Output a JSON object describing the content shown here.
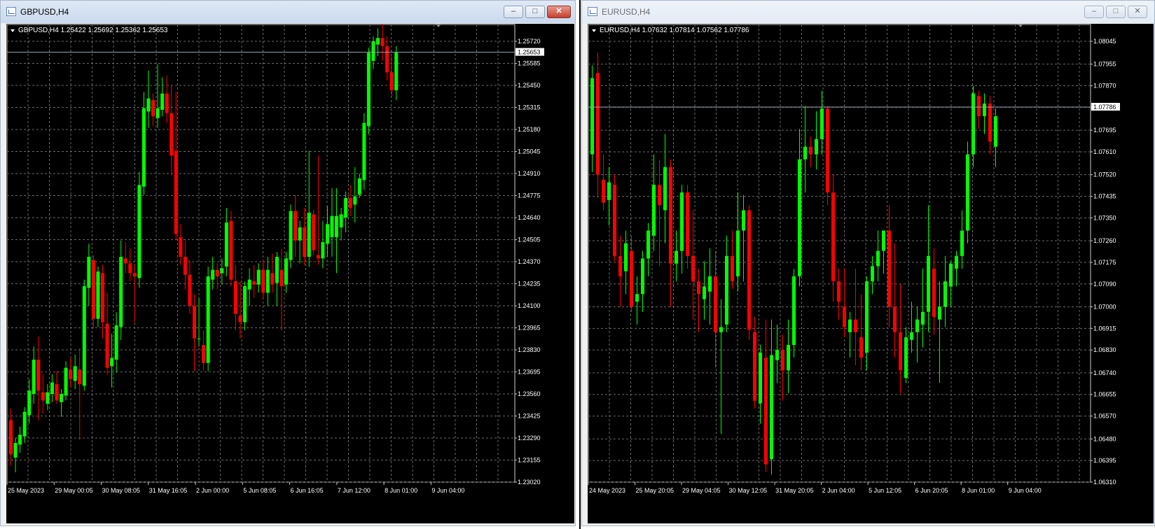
{
  "windows": [
    {
      "title": "GBPUSD,H4",
      "header": "GBPUSD,H4  1.25422 1.25692 1.25362 1.25653",
      "current_price": "1.25653",
      "chart_data": {
        "type": "candlestick",
        "symbol": "GBPUSD",
        "timeframe": "H4",
        "ylim": [
          1.2302,
          1.2579
        ],
        "y_ticks": [
          "1.25720",
          "1.25585",
          "1.25450",
          "1.25315",
          "1.25180",
          "1.25045",
          "1.24910",
          "1.24775",
          "1.24640",
          "1.24505",
          "1.24370",
          "1.24235",
          "1.24100",
          "1.23965",
          "1.23830",
          "1.23695",
          "1.23560",
          "1.23425",
          "1.23290",
          "1.23155",
          "1.23020"
        ],
        "x_labels": [
          "25 May 2023",
          "29 May 00:05",
          "30 May 08:05",
          "31 May 16:05",
          "2 Jun 00:00",
          "5 Jun 08:05",
          "6 Jun 16:05",
          "7 Jun 12:00",
          "8 Jun 01:00",
          "9 Jun 04:00"
        ],
        "last_price": 1.25653,
        "candles": [
          [
            1.234,
            1.2347,
            1.2312,
            1.2319
          ],
          [
            1.2317,
            1.2329,
            1.2308,
            1.2326
          ],
          [
            1.2325,
            1.2336,
            1.232,
            1.2331
          ],
          [
            1.233,
            1.2348,
            1.2326,
            1.2345
          ],
          [
            1.2343,
            1.2365,
            1.2338,
            1.2358
          ],
          [
            1.2356,
            1.2385,
            1.235,
            1.2377
          ],
          [
            1.2377,
            1.2391,
            1.234,
            1.2358
          ],
          [
            1.2357,
            1.2368,
            1.2344,
            1.2352
          ],
          [
            1.235,
            1.2362,
            1.2346,
            1.2357
          ],
          [
            1.2356,
            1.2368,
            1.2351,
            1.2363
          ],
          [
            1.2362,
            1.237,
            1.235,
            1.2352
          ],
          [
            1.2351,
            1.2359,
            1.2342,
            1.2356
          ],
          [
            1.2355,
            1.2376,
            1.2352,
            1.2372
          ],
          [
            1.2371,
            1.2378,
            1.236,
            1.2365
          ],
          [
            1.2364,
            1.238,
            1.2359,
            1.2373
          ],
          [
            1.2371,
            1.2384,
            1.2328,
            1.2362
          ],
          [
            1.2361,
            1.2426,
            1.2358,
            1.2422
          ],
          [
            1.2421,
            1.2448,
            1.241,
            1.244
          ],
          [
            1.2438,
            1.2441,
            1.2396,
            1.2402
          ],
          [
            1.2402,
            1.2434,
            1.2397,
            1.2431
          ],
          [
            1.243,
            1.2435,
            1.239,
            1.24
          ],
          [
            1.2399,
            1.2418,
            1.2368,
            1.2372
          ],
          [
            1.2373,
            1.2393,
            1.236,
            1.2378
          ],
          [
            1.2377,
            1.2406,
            1.2369,
            1.2398
          ],
          [
            1.2397,
            1.245,
            1.2389,
            1.244
          ],
          [
            1.2439,
            1.2449,
            1.243,
            1.2436
          ],
          [
            1.2436,
            1.2445,
            1.2425,
            1.243
          ],
          [
            1.243,
            1.2435,
            1.24,
            1.2428
          ],
          [
            1.2427,
            1.2492,
            1.2421,
            1.2484
          ],
          [
            1.2483,
            1.2541,
            1.2478,
            1.2531
          ],
          [
            1.2529,
            1.2554,
            1.2519,
            1.2537
          ],
          [
            1.2536,
            1.254,
            1.252,
            1.2526
          ],
          [
            1.2525,
            1.2558,
            1.2519,
            1.2531
          ],
          [
            1.253,
            1.255,
            1.2526,
            1.254
          ],
          [
            1.254,
            1.2551,
            1.2522,
            1.2528
          ],
          [
            1.2528,
            1.2545,
            1.249,
            1.2502
          ],
          [
            1.2505,
            1.2541,
            1.245,
            1.2454
          ],
          [
            1.2452,
            1.246,
            1.2435,
            1.244
          ],
          [
            1.244,
            1.245,
            1.242,
            1.2429
          ],
          [
            1.2429,
            1.2438,
            1.2405,
            1.241
          ],
          [
            1.241,
            1.2417,
            1.237,
            1.239
          ],
          [
            1.239,
            1.2415,
            1.2385,
            1.239
          ],
          [
            1.2386,
            1.2395,
            1.237,
            1.2375
          ],
          [
            1.2375,
            1.2434,
            1.237,
            1.2428
          ],
          [
            1.2426,
            1.244,
            1.242,
            1.2432
          ],
          [
            1.2432,
            1.2436,
            1.242,
            1.2428
          ],
          [
            1.243,
            1.2439,
            1.2423,
            1.2433
          ],
          [
            1.2434,
            1.247,
            1.2428,
            1.2461
          ],
          [
            1.2462,
            1.2468,
            1.2422,
            1.2426
          ],
          [
            1.2425,
            1.2435,
            1.2395,
            1.2405
          ],
          [
            1.2404,
            1.2425,
            1.239,
            1.24
          ],
          [
            1.24,
            1.2425,
            1.2395,
            1.2422
          ],
          [
            1.242,
            1.2433,
            1.241,
            1.2426
          ],
          [
            1.2425,
            1.2435,
            1.2415,
            1.2423
          ],
          [
            1.2423,
            1.2436,
            1.2418,
            1.2432
          ],
          [
            1.2432,
            1.2438,
            1.2414,
            1.2418
          ],
          [
            1.2418,
            1.244,
            1.241,
            1.2432
          ],
          [
            1.243,
            1.2442,
            1.2418,
            1.2423
          ],
          [
            1.2424,
            1.2443,
            1.241,
            1.244
          ],
          [
            1.2432,
            1.2445,
            1.2395,
            1.2422
          ],
          [
            1.2423,
            1.2443,
            1.2418,
            1.2439
          ],
          [
            1.2438,
            1.2472,
            1.2433,
            1.2468
          ],
          [
            1.2468,
            1.2478,
            1.244,
            1.245
          ],
          [
            1.245,
            1.2462,
            1.2436,
            1.2458
          ],
          [
            1.2458,
            1.247,
            1.2435,
            1.244
          ],
          [
            1.244,
            1.2505,
            1.2434,
            1.2467
          ],
          [
            1.2466,
            1.2469,
            1.2441,
            1.2444
          ],
          [
            1.2441,
            1.2502,
            1.2435,
            1.2439
          ],
          [
            1.2439,
            1.2462,
            1.2433,
            1.2449
          ],
          [
            1.2448,
            1.2471,
            1.244,
            1.246
          ],
          [
            1.2452,
            1.2482,
            1.244,
            1.2465
          ],
          [
            1.2452,
            1.2482,
            1.243,
            1.2465
          ],
          [
            1.2458,
            1.247,
            1.245,
            1.2466
          ],
          [
            1.2464,
            1.248,
            1.2455,
            1.2476
          ],
          [
            1.2476,
            1.2484,
            1.2465,
            1.247
          ],
          [
            1.2472,
            1.2495,
            1.2461,
            1.2477
          ],
          [
            1.2478,
            1.2491,
            1.2476,
            1.2488
          ],
          [
            1.2487,
            1.2528,
            1.2481,
            1.2522
          ],
          [
            1.252,
            1.2568,
            1.2515,
            1.2565
          ],
          [
            1.256,
            1.2575,
            1.2555,
            1.2572
          ],
          [
            1.257,
            1.258,
            1.2563,
            1.2574
          ],
          [
            1.2574,
            1.2583,
            1.256,
            1.2569
          ],
          [
            1.2569,
            1.2575,
            1.2548,
            1.2553
          ],
          [
            1.2553,
            1.2563,
            1.2538,
            1.2542
          ],
          [
            1.2542,
            1.2569,
            1.2536,
            1.2565
          ]
        ]
      }
    },
    {
      "title": "EURUSD,H4",
      "header": "EURUSD,H4  1.07632 1.07814 1.07562 1.07786",
      "current_price": "1.07786",
      "chart_data": {
        "type": "candlestick",
        "symbol": "EURUSD",
        "timeframe": "H4",
        "ylim": [
          1.0631,
          1.081
        ],
        "y_ticks": [
          "1.08045",
          "1.07955",
          "1.07870",
          "1.07785",
          "1.07695",
          "1.07610",
          "1.07520",
          "1.07435",
          "1.07350",
          "1.07260",
          "1.07175",
          "1.07090",
          "1.07000",
          "1.06915",
          "1.06830",
          "1.06740",
          "1.06655",
          "1.06570",
          "1.06480",
          "1.06395",
          "1.06310"
        ],
        "x_labels": [
          "24 May 2023",
          "25 May 20:05",
          "29 May 04:05",
          "30 May 12:05",
          "31 May 20:05",
          "2 Jun 04:00",
          "5 Jun 12:05",
          "6 Jun 20:05",
          "8 Jun 01:00",
          "9 Jun 04:00"
        ],
        "last_price": 1.07786,
        "candles": [
          [
            1.076,
            1.0795,
            1.0753,
            1.079
          ],
          [
            1.0792,
            1.08,
            1.0743,
            1.0752
          ],
          [
            1.075,
            1.076,
            1.0738,
            1.0741
          ],
          [
            1.0742,
            1.0755,
            1.0732,
            1.0749
          ],
          [
            1.0748,
            1.0752,
            1.0718,
            1.072
          ],
          [
            1.072,
            1.0728,
            1.07,
            1.0712
          ],
          [
            1.0714,
            1.073,
            1.0705,
            1.0725
          ],
          [
            1.0722,
            1.0728,
            1.0698,
            1.07
          ],
          [
            1.0702,
            1.0712,
            1.0693,
            1.0705
          ],
          [
            1.0705,
            1.0722,
            1.0698,
            1.0719
          ],
          [
            1.0719,
            1.0733,
            1.0712,
            1.073
          ],
          [
            1.0728,
            1.076,
            1.0722,
            1.0748
          ],
          [
            1.0748,
            1.0758,
            1.0716,
            1.074
          ],
          [
            1.0738,
            1.0768,
            1.0725,
            1.0755
          ],
          [
            1.0755,
            1.0758,
            1.07,
            1.0717
          ],
          [
            1.0717,
            1.073,
            1.071,
            1.0722
          ],
          [
            1.0722,
            1.0748,
            1.0713,
            1.0745
          ],
          [
            1.0745,
            1.0748,
            1.0715,
            1.072
          ],
          [
            1.072,
            1.0738,
            1.0695,
            1.071
          ],
          [
            1.071,
            1.0715,
            1.069,
            1.0705
          ],
          [
            1.0703,
            1.0718,
            1.0695,
            1.0708
          ],
          [
            1.0706,
            1.0723,
            1.0693,
            1.0712
          ],
          [
            1.0712,
            1.0722,
            1.0676,
            1.069
          ],
          [
            1.069,
            1.0703,
            1.065,
            1.0692
          ],
          [
            1.0693,
            1.0728,
            1.069,
            1.072
          ],
          [
            1.072,
            1.073,
            1.0707,
            1.071
          ],
          [
            1.0712,
            1.0745,
            1.0706,
            1.073
          ],
          [
            1.073,
            1.0744,
            1.071,
            1.0738
          ],
          [
            1.0738,
            1.074,
            1.0687,
            1.0691
          ],
          [
            1.069,
            1.0696,
            1.066,
            1.0663
          ],
          [
            1.0662,
            1.0685,
            1.0654,
            1.0682
          ],
          [
            1.068,
            1.0695,
            1.0635,
            1.0638
          ],
          [
            1.064,
            1.0695,
            1.0634,
            1.0681
          ],
          [
            1.0679,
            1.0693,
            1.067,
            1.0683
          ],
          [
            1.0683,
            1.0689,
            1.0663,
            1.0675
          ],
          [
            1.0675,
            1.0695,
            1.0666,
            1.0685
          ],
          [
            1.0685,
            1.0715,
            1.068,
            1.0712
          ],
          [
            1.0712,
            1.077,
            1.0708,
            1.0758
          ],
          [
            1.0758,
            1.0779,
            1.0745,
            1.0763
          ],
          [
            1.0763,
            1.0767,
            1.0755,
            1.076
          ],
          [
            1.076,
            1.0777,
            1.0754,
            1.0766
          ],
          [
            1.0766,
            1.0785,
            1.076,
            1.0778
          ],
          [
            1.0778,
            1.0779,
            1.074,
            1.0745
          ],
          [
            1.0745,
            1.0752,
            1.0702,
            1.071
          ],
          [
            1.071,
            1.0715,
            1.0695,
            1.0702
          ],
          [
            1.07,
            1.0715,
            1.0688,
            1.0692
          ],
          [
            1.069,
            1.0698,
            1.068,
            1.0695
          ],
          [
            1.0695,
            1.0715,
            1.0677,
            1.069
          ],
          [
            1.0688,
            1.0705,
            1.0675,
            1.068
          ],
          [
            1.0682,
            1.0712,
            1.0675,
            1.071
          ],
          [
            1.071,
            1.072,
            1.0705,
            1.0716
          ],
          [
            1.0716,
            1.073,
            1.071,
            1.0722
          ],
          [
            1.0722,
            1.0729,
            1.0713,
            1.073
          ],
          [
            1.073,
            1.074,
            1.0692,
            1.07
          ],
          [
            1.07,
            1.0725,
            1.068,
            1.069
          ],
          [
            1.069,
            1.0709,
            1.0666,
            1.0675
          ],
          [
            1.0672,
            1.0692,
            1.067,
            1.0688
          ],
          [
            1.0687,
            1.0702,
            1.0682,
            1.069
          ],
          [
            1.069,
            1.07,
            1.0678,
            1.0695
          ],
          [
            1.0693,
            1.0715,
            1.0684,
            1.0698
          ],
          [
            1.0698,
            1.074,
            1.069,
            1.072
          ],
          [
            1.0715,
            1.0723,
            1.0689,
            1.0696
          ],
          [
            1.0695,
            1.071,
            1.067,
            1.07
          ],
          [
            1.07,
            1.072,
            1.0692,
            1.071
          ],
          [
            1.0708,
            1.0718,
            1.07,
            1.0717
          ],
          [
            1.0715,
            1.0722,
            1.0708,
            1.072
          ],
          [
            1.072,
            1.0738,
            1.0715,
            1.073
          ],
          [
            1.073,
            1.0765,
            1.0725,
            1.076
          ],
          [
            1.076,
            1.0787,
            1.0755,
            1.0784
          ],
          [
            1.0783,
            1.0785,
            1.077,
            1.0775
          ],
          [
            1.0775,
            1.0784,
            1.0768,
            1.078
          ],
          [
            1.078,
            1.0783,
            1.076,
            1.0765
          ],
          [
            1.0763,
            1.0778,
            1.0755,
            1.0775
          ]
        ]
      }
    }
  ],
  "colors": {
    "bull": "#00ff00",
    "bear": "#ff0000",
    "grid": "#6a6a6a",
    "axis_text": "#ffffff",
    "background": "#000000"
  }
}
